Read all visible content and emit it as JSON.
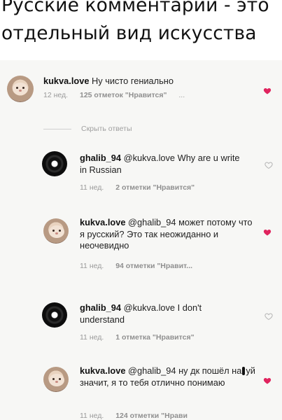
{
  "caption": {
    "line1": "Русские комментарии - это",
    "line2": "отдельный вид искусства"
  },
  "hide_replies": "Скрыть ответы",
  "comments": [
    {
      "username": "kukva.love",
      "mention": "",
      "text": "Ну чисто гениально",
      "time": "12 нед.",
      "likes": "125 отметок \"Нравится\"",
      "extra": "...",
      "liked": true
    },
    {
      "username": "ghalib_94",
      "mention": "@kukva.love",
      "text": "Why are u write in Russian",
      "time": "11 нед.",
      "likes": "2 отметки \"Нравится\"",
      "liked": false
    },
    {
      "username": "kukva.love",
      "mention": "@ghalib_94",
      "text": "может потому что я русский? Это так неожиданно и неочевидно",
      "time": "11 нед.",
      "likes": "94 отметки \"Нравит...",
      "liked": true
    },
    {
      "username": "ghalib_94",
      "mention": "@kukva.love",
      "text": "I don't understand",
      "time": "11 нед.",
      "likes": "1 отметка \"Нравится\"",
      "liked": false
    },
    {
      "username": "kukva.love",
      "mention": "@ghalib_94",
      "text_a": "ну дк пошёл на",
      "text_b": "уй значит, я то тебя отлично понимаю",
      "time": "11 нед.",
      "likes": "124 отметки \"Нрави",
      "liked": true
    }
  ],
  "colors": {
    "liked_heart": "#e0245e",
    "unliked_heart": "#b5b5b5"
  }
}
